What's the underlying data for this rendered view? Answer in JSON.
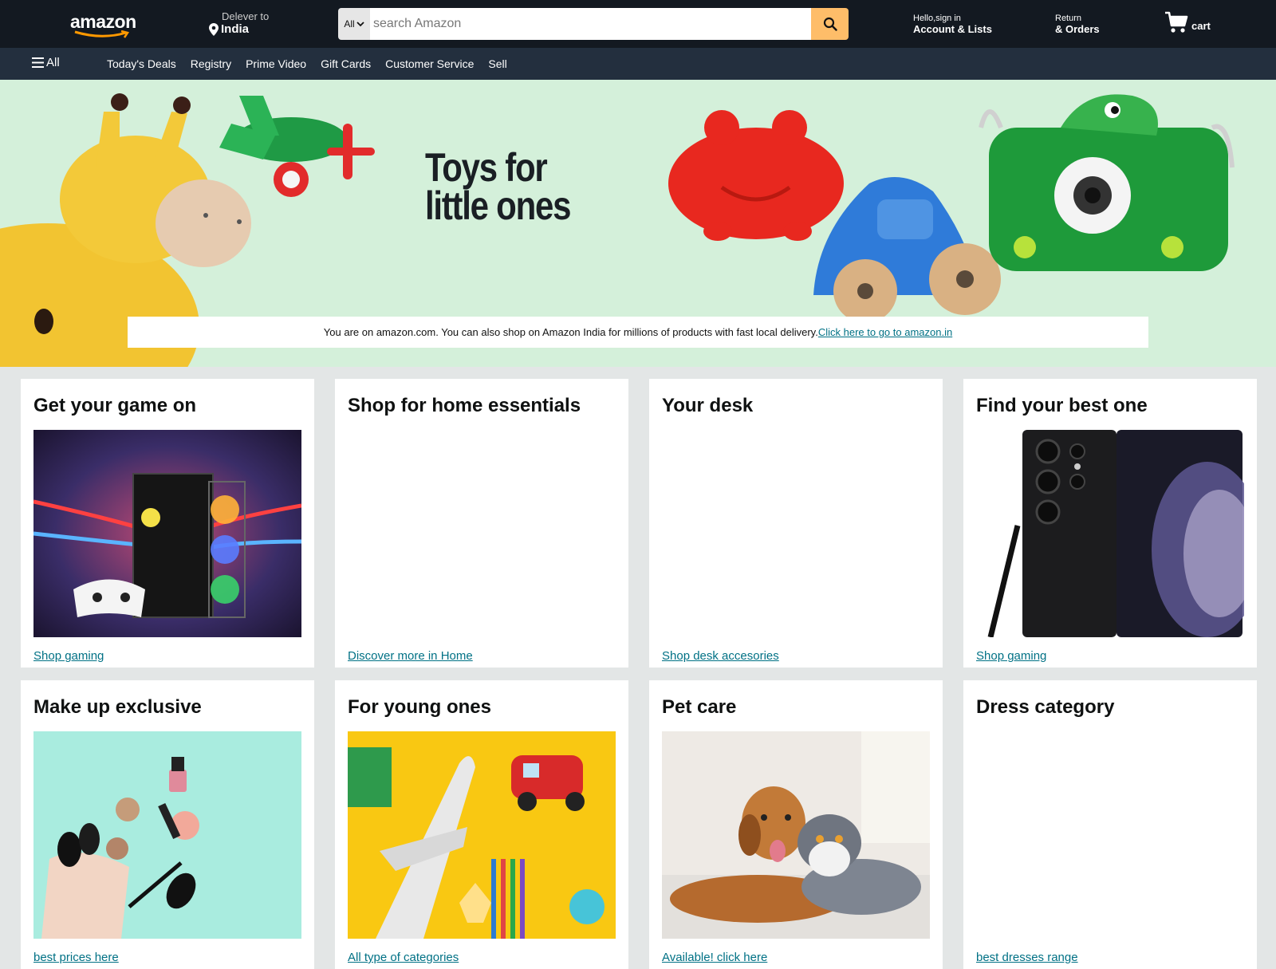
{
  "header": {
    "logo_text": "amazon",
    "deliver_small": "Delever to",
    "deliver_location": "India",
    "search_category": "All",
    "search_placeholder": "search Amazon",
    "account_small": "Hello,sign in",
    "account_big": "Account & Lists",
    "returns_small": "Return",
    "returns_big": "& Orders",
    "cart_label": "cart"
  },
  "subnav": {
    "all_label": "All",
    "links": [
      "Today's Deals",
      "Registry",
      "Prime Video",
      "Gift Cards",
      "Customer Service",
      "Sell"
    ]
  },
  "hero": {
    "title_line1": "Toys for",
    "title_line2": "little ones",
    "notice_text": "You are on amazon.com. You can also shop on Amazon India for millions of products with fast local delivery.",
    "notice_link": "Click here to go to amazon.in"
  },
  "cards": [
    {
      "title": "Get your game on",
      "link": "Shop gaming"
    },
    {
      "title": "Shop for home essentials",
      "link": "Discover more in Home"
    },
    {
      "title": "Your desk",
      "link": "Shop desk accesories"
    },
    {
      "title": "Find your best one",
      "link": "Shop gaming"
    },
    {
      "title": "Make up exclusive",
      "link": "best prices here"
    },
    {
      "title": "For young ones",
      "link": "All type of categories"
    },
    {
      "title": "Pet care",
      "link": "Available! click here"
    },
    {
      "title": "Dress category",
      "link": "best dresses range"
    }
  ],
  "colors": {
    "nav_bg": "#131921",
    "subnav_bg": "#232f3e",
    "search_button": "#febd69",
    "hero_bg": "#d4f0da",
    "link": "#007185",
    "page_bg": "#e3e6e6"
  }
}
